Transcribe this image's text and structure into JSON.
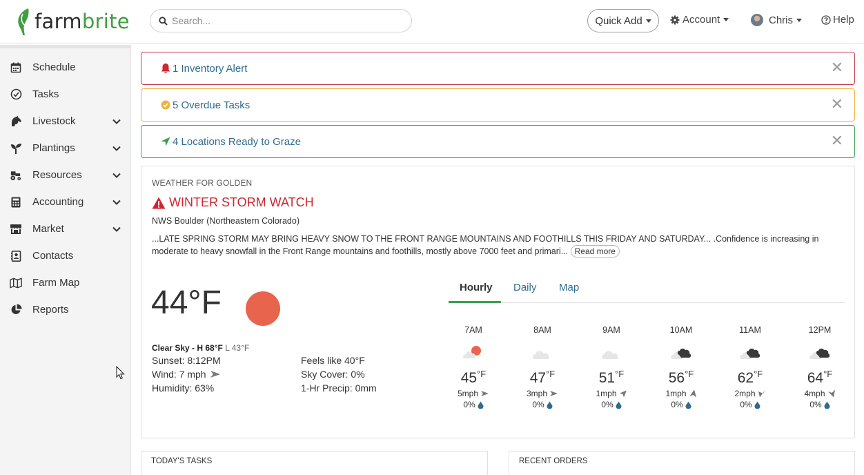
{
  "brand": {
    "part1": "farm",
    "part2": "brite"
  },
  "search": {
    "placeholder": "Search..."
  },
  "header": {
    "quick_add": "Quick Add",
    "account": "Account",
    "user": "Chris",
    "help": "Help"
  },
  "sidebar": {
    "items": [
      {
        "label": "Schedule",
        "icon": "calendar-icon",
        "expandable": false
      },
      {
        "label": "Tasks",
        "icon": "check-circle-icon",
        "expandable": false
      },
      {
        "label": "Livestock",
        "icon": "horse-icon",
        "expandable": true
      },
      {
        "label": "Plantings",
        "icon": "seedling-icon",
        "expandable": true
      },
      {
        "label": "Resources",
        "icon": "tractor-icon",
        "expandable": true
      },
      {
        "label": "Accounting",
        "icon": "calculator-icon",
        "expandable": true
      },
      {
        "label": "Market",
        "icon": "store-icon",
        "expandable": true
      },
      {
        "label": "Contacts",
        "icon": "address-book-icon",
        "expandable": false
      },
      {
        "label": "Farm Map",
        "icon": "map-icon",
        "expandable": false
      },
      {
        "label": "Reports",
        "icon": "pie-chart-icon",
        "expandable": false
      }
    ]
  },
  "alerts": {
    "inventory": "1 Inventory Alert",
    "overdue": "5 Overdue Tasks",
    "graze": "4 Locations Ready to Graze",
    "colors": {
      "red": "#c6384f",
      "amber": "#f0b23b",
      "green": "#3aa14a"
    }
  },
  "weather": {
    "caption": "WEATHER FOR GOLDEN",
    "headline": "WINTER STORM WATCH",
    "office": "NWS Boulder (Northeastern Colorado)",
    "text": "...LATE SPRING STORM MAY BRING HEAVY SNOW TO THE FRONT RANGE MOUNTAINS AND FOOTHILLS THIS FRIDAY AND SATURDAY... .Confidence is increasing in moderate to heavy snowfall in the Front Range mountains and foothills, mostly above 7000 feet and primari...",
    "read_more": "Read more",
    "current_temp": "44°F",
    "condition": "Clear Sky - H 68°F",
    "low": "L 43°F",
    "sunset": "Sunset: 8:12PM",
    "wind": "Wind: 7 mph",
    "humidity": "Humidity: 63%",
    "feels_like": "Feels like 40°F",
    "sky_cover": "Sky Cover: 0%",
    "precip": "1-Hr Precip: 0mm",
    "tabs": [
      "Hourly",
      "Daily",
      "Map"
    ],
    "hourly": [
      {
        "time": "7AM",
        "temp": "45",
        "unit": "°F",
        "wind": "5mph",
        "precip": "0%",
        "icon": "partly-sunny-icon"
      },
      {
        "time": "8AM",
        "temp": "47",
        "unit": "°F",
        "wind": "3mph",
        "precip": "0%",
        "icon": "cloud-icon"
      },
      {
        "time": "9AM",
        "temp": "51",
        "unit": "°F",
        "wind": "1mph",
        "precip": "0%",
        "icon": "cloud-icon"
      },
      {
        "time": "10AM",
        "temp": "56",
        "unit": "°F",
        "wind": "1mph",
        "precip": "0%",
        "icon": "cloudy-icon"
      },
      {
        "time": "11AM",
        "temp": "62",
        "unit": "°F",
        "wind": "2mph",
        "precip": "0%",
        "icon": "cloudy-icon"
      },
      {
        "time": "12PM",
        "temp": "64",
        "unit": "°F",
        "wind": "4mph",
        "precip": "0%",
        "icon": "cloudy-icon"
      }
    ]
  },
  "panels": {
    "tasks_title": "TODAY'S TASKS",
    "orders_title": "RECENT ORDERS"
  }
}
